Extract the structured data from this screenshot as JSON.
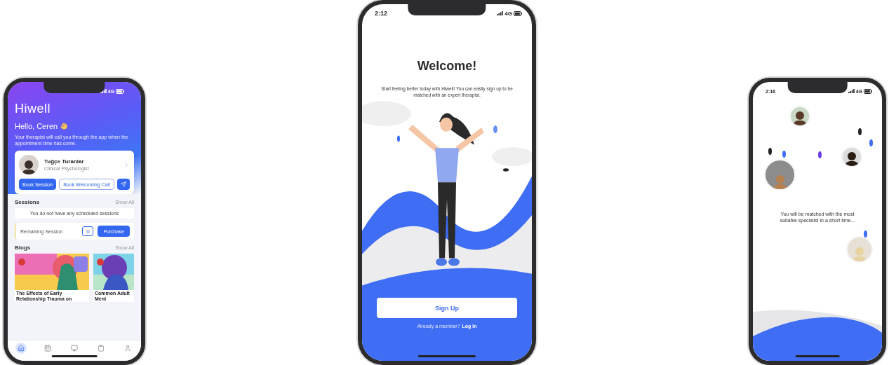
{
  "phones": [
    {
      "kind": "home",
      "status": {
        "network": "4G"
      },
      "logo": "Hiwell",
      "greeting": "Hello, Ceren",
      "intro": "Your therapist will call you through the app when the appointment time has come.",
      "therapist": {
        "name": "Tuğçe Turanlar",
        "role": "Clinical Psychologist"
      },
      "actions": [
        {
          "kind": "primary",
          "label": "Book Session"
        },
        {
          "kind": "outline",
          "label": "Book Welcoming Call"
        },
        {
          "kind": "send"
        }
      ],
      "sessions": {
        "title": "Sessions",
        "link": "Show All",
        "empty": "You do not have any scheduled sessions"
      },
      "remaining": {
        "label": "Remaining Session",
        "count": "0",
        "button": "Purchase"
      },
      "blogs": {
        "title": "Blogs",
        "link": "Show All",
        "items": [
          {
            "title": "The Effects of Early Relationship Trauma on"
          },
          {
            "title": "Common Adult Ment"
          }
        ]
      },
      "nav": [
        {
          "kind": "home",
          "selected": true
        },
        {
          "kind": "calendar",
          "selected": false
        },
        {
          "kind": "video",
          "selected": false
        },
        {
          "kind": "clipboard",
          "selected": false
        },
        {
          "kind": "profile",
          "selected": false
        }
      ]
    },
    {
      "kind": "welcome",
      "status": {
        "time": "2:12",
        "network": "4G"
      },
      "title": "Welcome!",
      "text": "Start feeling better today with Hiwell! You can easily sign up to be matched with an expert therapist.",
      "button": "Sign Up",
      "prompt": "Already a member?",
      "link": "Log In"
    },
    {
      "kind": "matching",
      "status": {
        "time": "2:16",
        "network": "4G"
      },
      "text": "You will be matched with the most suitable specialist in a short time..."
    }
  ]
}
